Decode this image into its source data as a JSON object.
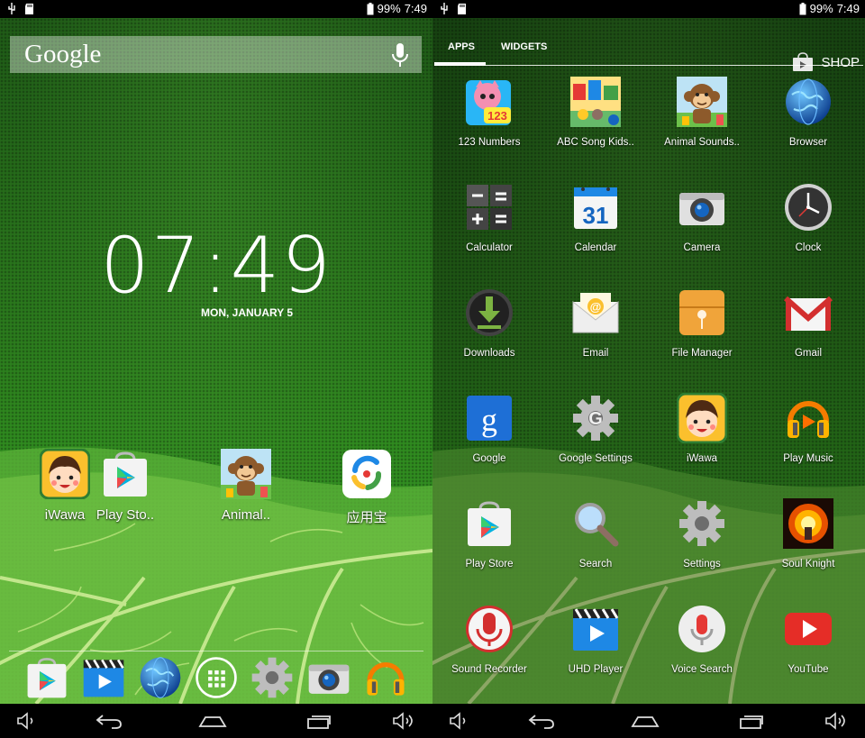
{
  "status_bar": {
    "battery": "99%",
    "time": "7:49"
  },
  "home": {
    "search": {
      "logo_text": "Google"
    },
    "clock": {
      "time": "07:49",
      "date": "MON, JANUARY 5"
    },
    "desktop_icons": [
      {
        "label": "iWawa",
        "icon": "iwawa-icon"
      },
      {
        "label": "Play Sto..",
        "icon": "play-store-icon"
      },
      {
        "label": "Animal..",
        "icon": "monkey-icon"
      },
      {
        "label": "应用宝",
        "icon": "app-treasure-icon"
      }
    ],
    "dock": [
      "play-store-icon",
      "video-player-icon",
      "browser-globe-icon",
      "all-apps-icon",
      "settings-gear-icon",
      "camera-icon",
      "headphones-icon"
    ]
  },
  "drawer": {
    "tabs": {
      "apps": "APPS",
      "widgets": "WIDGETS"
    },
    "shop_label": "SHOP",
    "apps": [
      "123 Numbers",
      "ABC Song Kids..",
      "Animal Sounds..",
      "Browser",
      "Calculator",
      "Calendar",
      "Camera",
      "Clock",
      "Downloads",
      "Email",
      "File Manager",
      "Gmail",
      "Google",
      "Google Settings",
      "iWawa",
      "Play Music",
      "Play Store",
      "Search",
      "Settings",
      "Soul Knight",
      "Sound Recorder",
      "UHD Player",
      "Voice Search",
      "YouTube"
    ],
    "calendar_day": "31"
  },
  "colors": {
    "wallpaper_green": "#2b7a1d",
    "accent_red": "#d32f2f",
    "youtube_red": "#e52d27"
  }
}
